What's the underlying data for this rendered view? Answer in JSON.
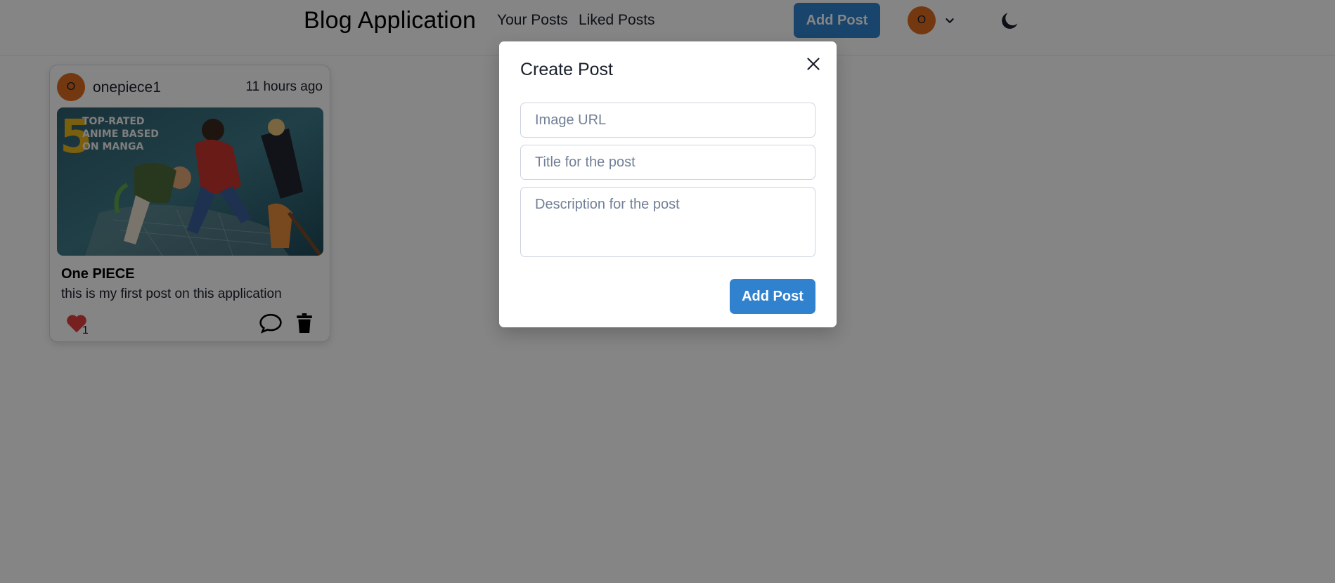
{
  "navbar": {
    "brand": "Blog Application",
    "links": [
      {
        "label": "Your Posts"
      },
      {
        "label": "Liked Posts"
      }
    ],
    "add_post_label": "Add Post",
    "avatar_initial": "O",
    "icons": {
      "menu": "chevron-down-icon",
      "theme": "moon-icon"
    }
  },
  "post": {
    "avatar_initial": "O",
    "username": "onepiece1",
    "time": "11 hours ago",
    "image_text": [
      "5",
      "TOP-RATED",
      "ANIME BASED",
      "ON MANGA"
    ],
    "title": "One PIECE",
    "description": "this is my first post on this application",
    "like_count": "1",
    "icons": {
      "like": "heart-icon",
      "comment": "comment-icon",
      "delete": "trash-icon"
    }
  },
  "modal": {
    "title": "Create Post",
    "close_icon": "close-icon",
    "image_url_placeholder": "Image URL",
    "title_placeholder": "Title for the post",
    "description_placeholder": "Description for the post",
    "submit_label": "Add Post"
  },
  "colors": {
    "primary": "#3182ce",
    "avatar": "#dd6b20",
    "like": "#e53e3e",
    "overlay": "rgba(0,0,0,0.48)"
  }
}
